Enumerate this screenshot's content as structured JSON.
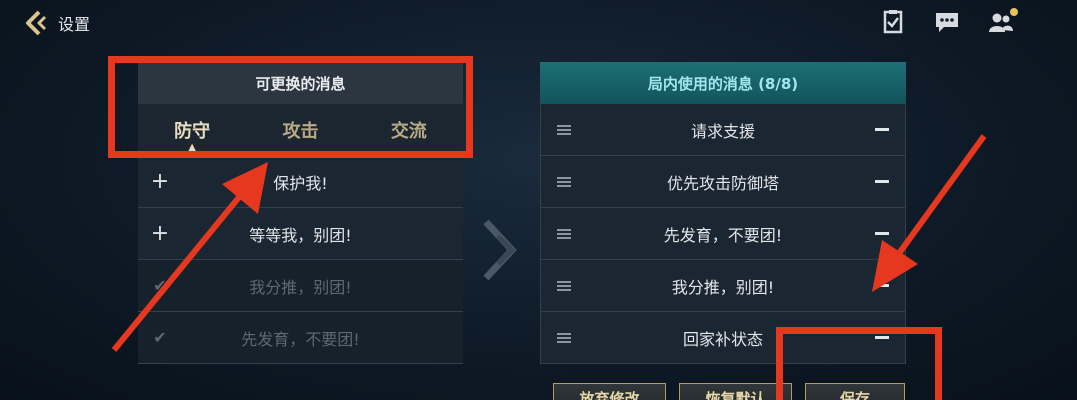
{
  "header": {
    "back_label": "设置",
    "icons": [
      "checklist-icon",
      "chat-icon",
      "friends-icon"
    ]
  },
  "left_panel": {
    "title": "可更换的消息",
    "tabs": [
      {
        "label": "防守",
        "active": true
      },
      {
        "label": "攻击",
        "active": false
      },
      {
        "label": "交流",
        "active": false
      }
    ],
    "items": [
      {
        "text": "保护我!",
        "state": "add"
      },
      {
        "text": "等等我，别团!",
        "state": "add"
      },
      {
        "text": "我分推，别团!",
        "state": "added"
      },
      {
        "text": "先发育，不要团!",
        "state": "added"
      }
    ]
  },
  "right_panel": {
    "title": "局内使用的消息 (8/8)",
    "items": [
      {
        "text": "请求支援"
      },
      {
        "text": "优先攻击防御塔"
      },
      {
        "text": "先发育，不要团!"
      },
      {
        "text": "我分推，别团!"
      },
      {
        "text": "回家补状态"
      }
    ]
  },
  "buttons": {
    "discard": "放弃修改",
    "restore": "恢复默认",
    "save": "保存"
  },
  "colors": {
    "annotation_red": "#e5381f",
    "accent_teal": "#1e6f77",
    "gold": "#b69a5e"
  }
}
